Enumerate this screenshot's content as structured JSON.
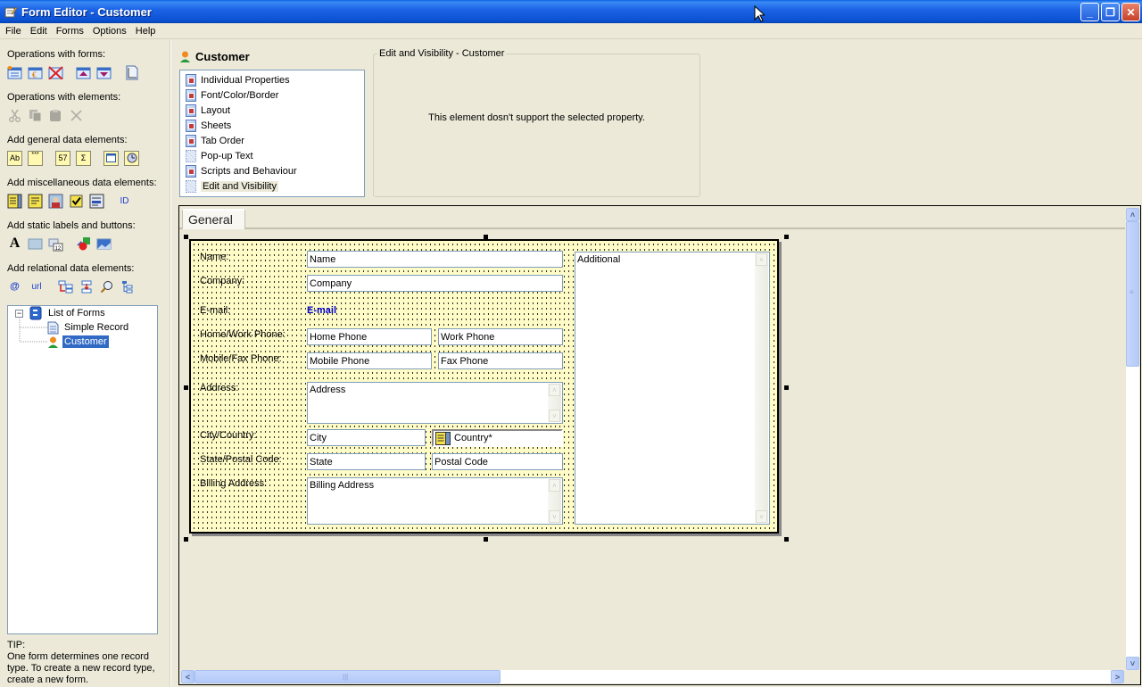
{
  "window": {
    "title": "Form Editor - Customer",
    "controls": {
      "minimize": "_",
      "restore": "❐",
      "close": "✕"
    }
  },
  "menu": [
    "File",
    "Edit",
    "Forms",
    "Options",
    "Help"
  ],
  "left_panel": {
    "sections": [
      {
        "label": "Operations with forms:",
        "icons": [
          "new-form-icon",
          "form-properties-icon",
          "delete-form-icon",
          "move-form-up-icon",
          "move-form-down-icon",
          "form-page-setup-icon"
        ]
      },
      {
        "label": "Operations with elements:",
        "icons": [
          "cut-icon",
          "copy-icon",
          "paste-icon",
          "delete-element-icon"
        ]
      },
      {
        "label": "Add general data elements:",
        "icons": [
          "text-field-icon",
          "password-field-icon",
          "number-field-icon",
          "formula-field-icon",
          "date-field-icon",
          "time-field-icon"
        ]
      },
      {
        "label": "Add miscellaneous data elements:",
        "icons": [
          "list-field-icon",
          "memo-field-icon",
          "picture-field-icon",
          "checkbox-field-icon",
          "rich-text-field-icon",
          "id-field-icon"
        ]
      },
      {
        "label": "Add static labels and buttons:",
        "icons": [
          "static-label-icon",
          "button-icon",
          "tab-sheet-icon",
          "shape-icon",
          "image-icon"
        ]
      },
      {
        "label": "Add relational data elements:",
        "icons": [
          "email-link-icon",
          "url-link-icon",
          "relation-field-icon",
          "lookup-field-icon",
          "search-field-icon",
          "tree-field-icon"
        ]
      }
    ],
    "icon_text": {
      "number": "57",
      "sigma": "Σ",
      "id": "ID",
      "at": "@",
      "url": "url",
      "label_a": "A",
      "abc": "Ab",
      "stars": "***"
    },
    "tree": {
      "root": "List of Forms",
      "expander": "−",
      "children": [
        {
          "label": "Simple Record",
          "selected": false
        },
        {
          "label": "Customer",
          "selected": true
        }
      ]
    },
    "tip": {
      "title": "TIP:",
      "text": "One form determines one record type. To create a new record type, create a new form."
    }
  },
  "properties": {
    "element_title": "Customer",
    "items": [
      {
        "label": "Individual Properties",
        "enabled": true
      },
      {
        "label": "Font/Color/Border",
        "enabled": true
      },
      {
        "label": "Layout",
        "enabled": true
      },
      {
        "label": "Sheets",
        "enabled": true
      },
      {
        "label": "Tab Order",
        "enabled": true
      },
      {
        "label": "Pop-up Text",
        "enabled": false
      },
      {
        "label": "Scripts and Behaviour",
        "enabled": true
      },
      {
        "label": "Edit and Visibility",
        "enabled": false,
        "selected": true
      }
    ],
    "group_title": "Edit and Visibility - Customer",
    "message": "This element dosn't support the selected property."
  },
  "designer": {
    "tabs": [
      {
        "label": "General",
        "active": true
      }
    ],
    "form": {
      "labels": {
        "name": "Name:",
        "company": "Company:",
        "email": "E-mail:",
        "home_work": "Home/Work Phone:",
        "mobile_fax": "Mobile/Fax Phone:",
        "address": "Address:",
        "city_country": "City/Country:",
        "state_postal": "State/Postal Code:",
        "billing": "Billing Address:"
      },
      "fields": {
        "name": "Name",
        "company": "Company",
        "email": "E-mail",
        "home_phone": "Home Phone",
        "work_phone": "Work Phone",
        "mobile_phone": "Mobile Phone",
        "fax_phone": "Fax Phone",
        "address": "Address",
        "city": "City",
        "country": "Country*",
        "state": "State",
        "postal_code": "Postal Code",
        "billing_address": "Billing Address",
        "additional": "Additional"
      },
      "email_color": "#0000cc",
      "canvas_color": "#fffcc8"
    },
    "scroll": {
      "up": "˄",
      "down": "˅",
      "left": "<",
      "right": ">",
      "grip_v": "≡",
      "grip_h": "|||"
    }
  }
}
